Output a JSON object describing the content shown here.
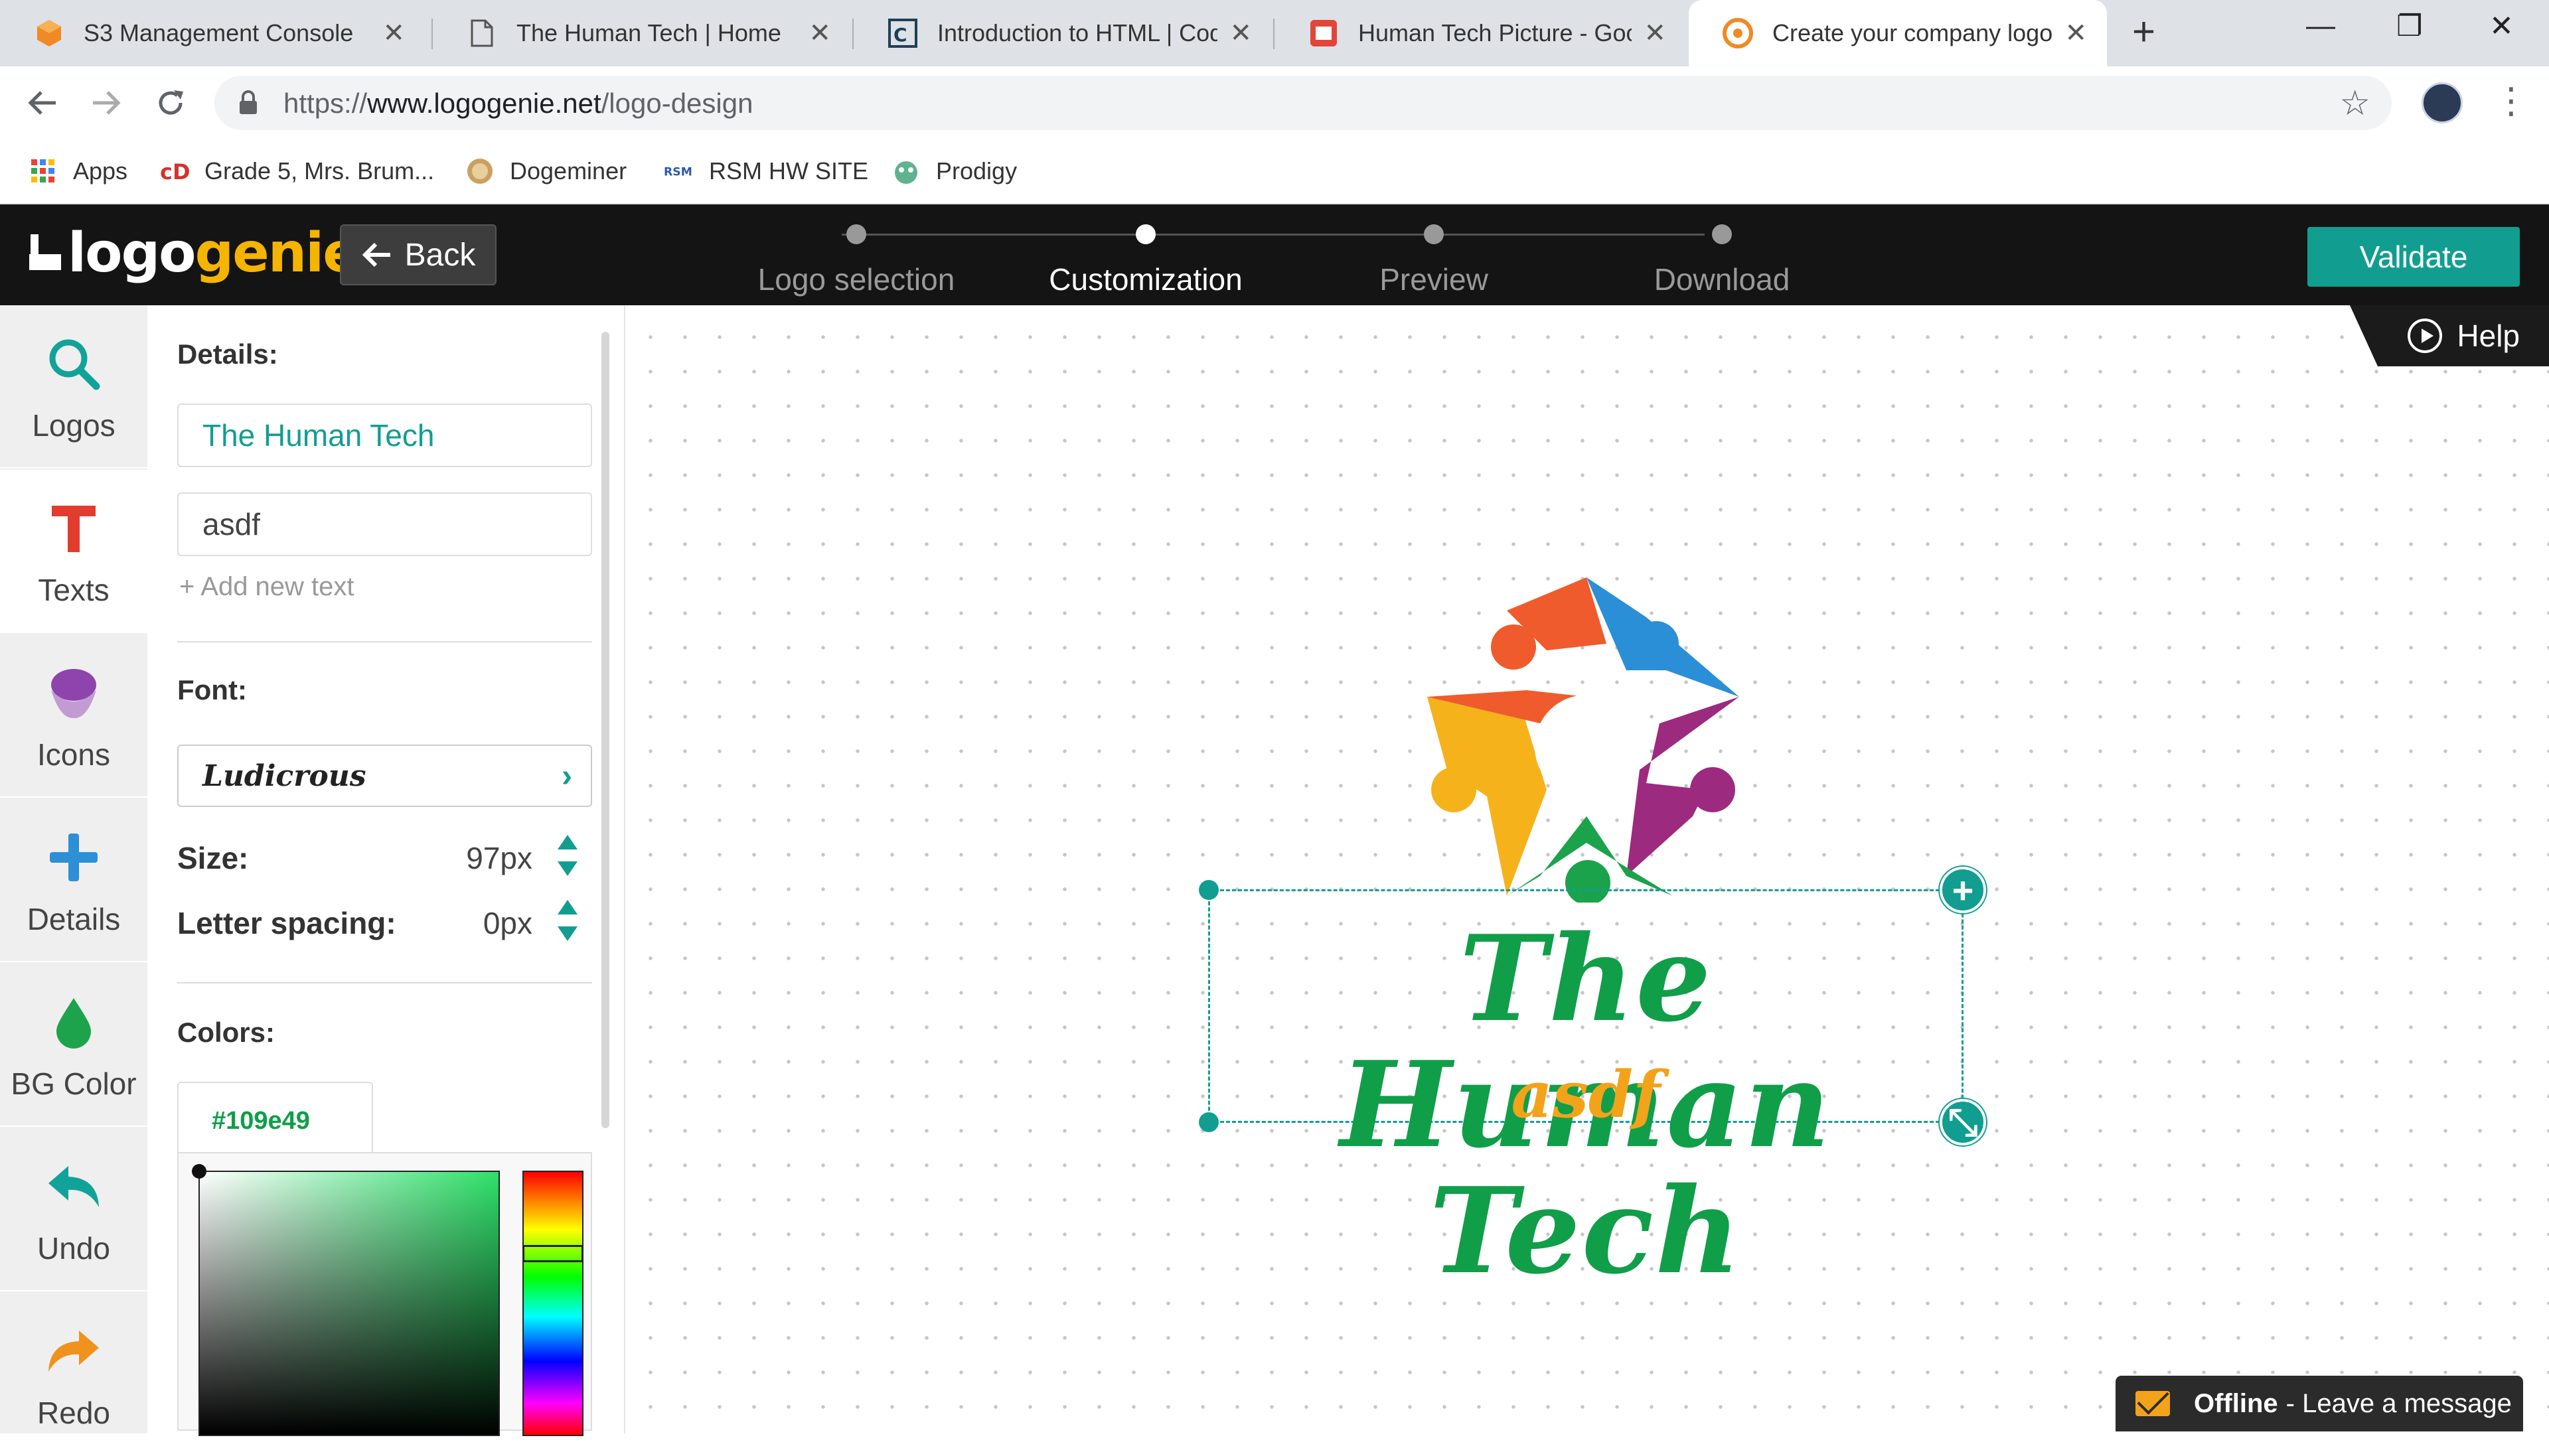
{
  "browser": {
    "tabs": [
      {
        "title": "S3 Management Console",
        "icon": "aws-cube-icon"
      },
      {
        "title": "The Human Tech | Home",
        "icon": "page-icon"
      },
      {
        "title": "Introduction to HTML | Cod",
        "icon": "codecademy-icon"
      },
      {
        "title": "Human Tech Picture - Goog",
        "icon": "google-slides-icon"
      },
      {
        "title": "Create your company logo",
        "icon": "logogenie-icon",
        "active": true
      }
    ],
    "url_scheme": "https://",
    "url_host": "www.logogenie.net",
    "url_path": "/logo-design",
    "bookmarks": [
      {
        "label": "Apps",
        "icon": "apps-grid-icon"
      },
      {
        "label": "Grade 5, Mrs. Brum...",
        "icon": "classdojo-icon"
      },
      {
        "label": "Dogeminer",
        "icon": "doge-icon"
      },
      {
        "label": "RSM HW SITE",
        "icon": "rsm-icon"
      },
      {
        "label": "Prodigy",
        "icon": "prodigy-icon"
      }
    ]
  },
  "app": {
    "logo_part1": "logo",
    "logo_part2": "genie",
    "back_label": "Back",
    "steps": [
      {
        "label": "Logo selection"
      },
      {
        "label": "Customization",
        "current": true
      },
      {
        "label": "Preview"
      },
      {
        "label": "Download"
      }
    ],
    "validate_label": "Validate",
    "help_label": "Help"
  },
  "leftnav": [
    {
      "label": "Logos",
      "icon": "magnifier-icon"
    },
    {
      "label": "Texts",
      "icon": "text-t-icon",
      "active": true
    },
    {
      "label": "Icons",
      "icon": "icons-shape-icon"
    },
    {
      "label": "Details",
      "icon": "plus-icon"
    },
    {
      "label": "BG Color",
      "icon": "droplet-icon"
    },
    {
      "label": "Undo",
      "icon": "undo-arrow-icon"
    },
    {
      "label": "Redo",
      "icon": "redo-arrow-icon"
    }
  ],
  "panel": {
    "details_label": "Details:",
    "text1": "The Human Tech",
    "text2": "asdf",
    "add_text": "+ Add new text",
    "font_label": "Font:",
    "font_name": "Ludicrous",
    "size_label": "Size:",
    "size_value": "97px",
    "spacing_label": "Letter spacing:",
    "spacing_value": "0px",
    "colors_label": "Colors:",
    "color_hex": "#109e49"
  },
  "canvas": {
    "brand_text": "The Human Tech",
    "slogan_text": "asdf",
    "brand_color": "#109e49",
    "slogan_color": "#f2a31a"
  },
  "chat": {
    "status": "Offline",
    "message": "- Leave a message"
  },
  "colors": {
    "accent": "#119e91",
    "header_bg": "#141414",
    "logo_yellow": "#f5b400"
  }
}
